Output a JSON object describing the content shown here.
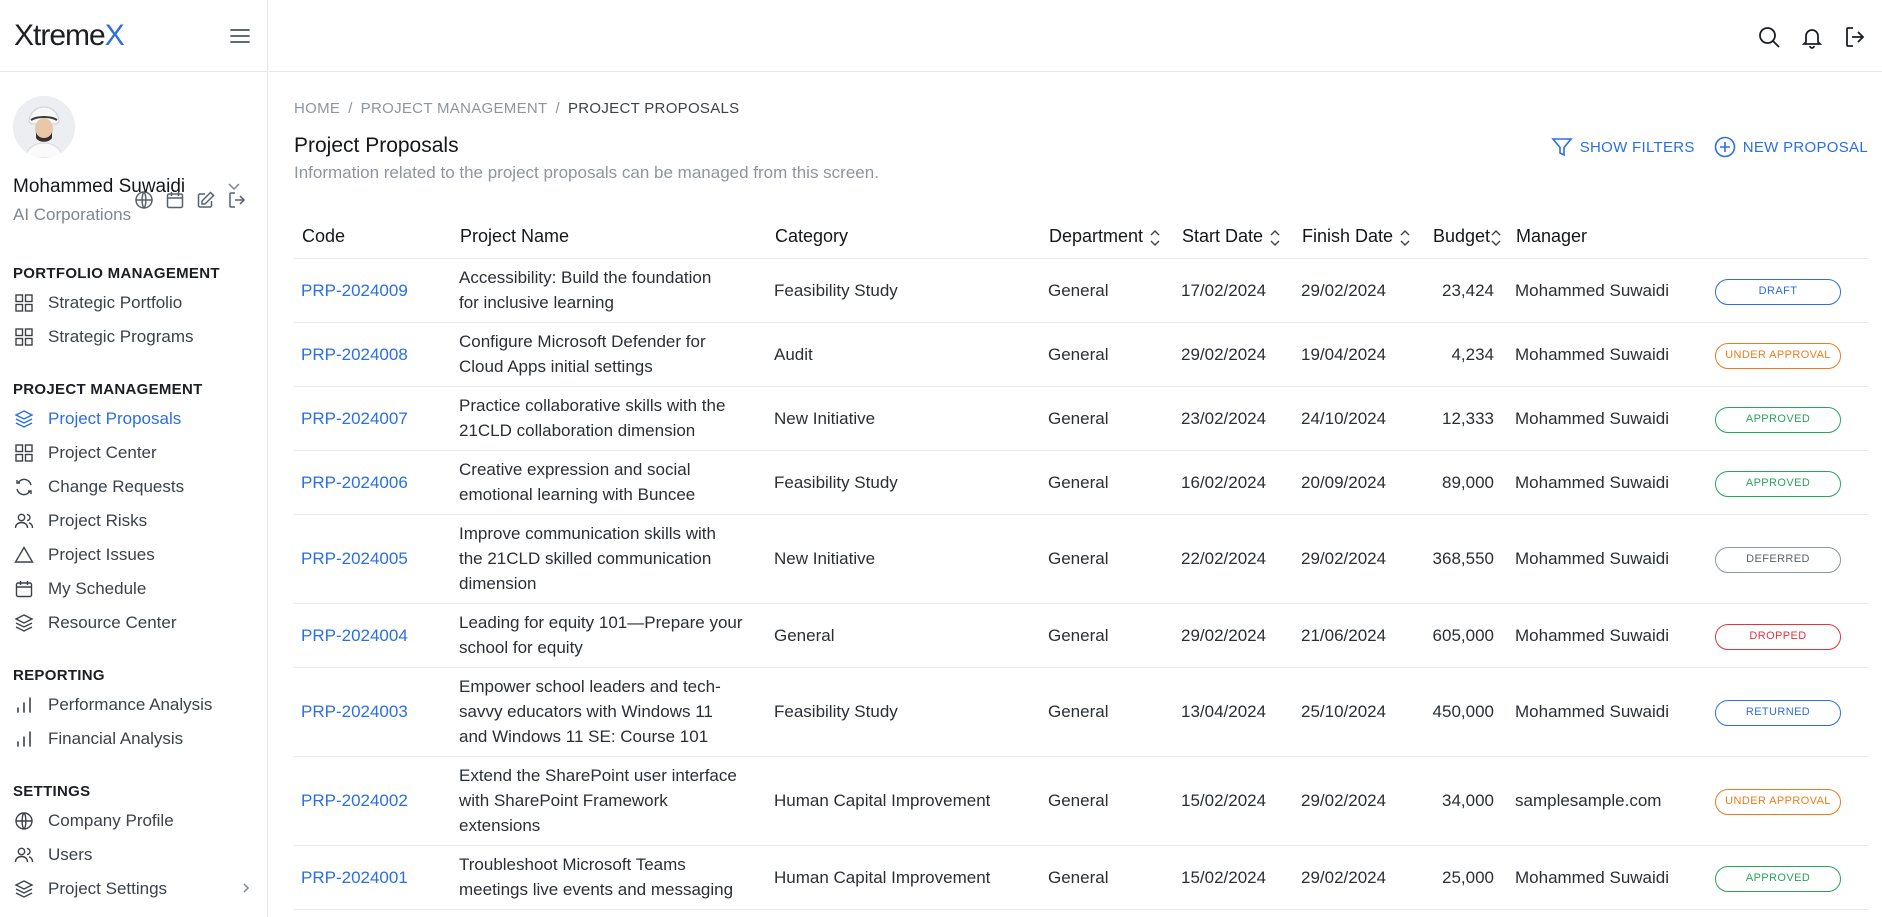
{
  "brand": {
    "prefix": "Xtreme",
    "suffix": "X"
  },
  "user": {
    "name": "Mohammed Suwaidi",
    "company": "AI Corporations"
  },
  "sidebar": {
    "sections": [
      {
        "title": "PORTFOLIO MANAGEMENT",
        "items": [
          {
            "label": "Strategic Portfolio",
            "icon": "grid-icon"
          },
          {
            "label": "Strategic Programs",
            "icon": "grid-icon"
          }
        ]
      },
      {
        "title": "PROJECT MANAGEMENT",
        "items": [
          {
            "label": "Project Proposals",
            "icon": "layers-icon",
            "active": true
          },
          {
            "label": "Project Center",
            "icon": "grid-icon"
          },
          {
            "label": "Change Requests",
            "icon": "refresh-icon"
          },
          {
            "label": "Project Risks",
            "icon": "users-icon"
          },
          {
            "label": "Project Issues",
            "icon": "warning-icon"
          },
          {
            "label": "My Schedule",
            "icon": "calendar-icon"
          },
          {
            "label": "Resource Center",
            "icon": "layers-icon"
          }
        ]
      },
      {
        "title": "REPORTING",
        "items": [
          {
            "label": "Performance Analysis",
            "icon": "bar-chart-icon"
          },
          {
            "label": "Financial Analysis",
            "icon": "bar-chart-icon"
          }
        ]
      },
      {
        "title": "SETTINGS",
        "items": [
          {
            "label": "Company Profile",
            "icon": "globe-icon"
          },
          {
            "label": "Users",
            "icon": "users-icon"
          },
          {
            "label": "Project Settings",
            "icon": "layers-icon",
            "has_submenu": true
          }
        ]
      }
    ]
  },
  "breadcrumb": {
    "home": "HOME",
    "section": "PROJECT MANAGEMENT",
    "current": "PROJECT PROPOSALS",
    "separator": "/"
  },
  "page": {
    "title": "Project Proposals",
    "subtitle": "Information related to the project proposals can be managed from this screen.",
    "show_filters": "SHOW FILTERS",
    "new_proposal": "NEW PROPOSAL"
  },
  "table": {
    "columns": {
      "code": "Code",
      "project_name": "Project Name",
      "category": "Category",
      "department": "Department",
      "start_date": "Start Date",
      "finish_date": "Finish Date",
      "budget": "Budget",
      "manager": "Manager"
    },
    "rows": [
      {
        "code": "PRP-2024009",
        "name": [
          "Accessibility: Build the foundation",
          "for inclusive learning"
        ],
        "category": "Feasibility Study",
        "department": "General",
        "start": "17/02/2024",
        "finish": "29/02/2024",
        "budget": "23,424",
        "manager": "Mohammed Suwaidi",
        "status": "DRAFT",
        "status_kind": "blue"
      },
      {
        "code": "PRP-2024008",
        "name": [
          "Configure Microsoft Defender for",
          "Cloud Apps initial settings"
        ],
        "category": "Audit",
        "department": "General",
        "start": "29/02/2024",
        "finish": "19/04/2024",
        "budget": "4,234",
        "manager": "Mohammed Suwaidi",
        "status": "UNDER APPROVAL",
        "status_kind": "orange"
      },
      {
        "code": "PRP-2024007",
        "name": [
          "Practice collaborative skills with the",
          "21CLD collaboration dimension"
        ],
        "category": "New Initiative",
        "department": "General",
        "start": "23/02/2024",
        "finish": "24/10/2024",
        "budget": "12,333",
        "manager": "Mohammed Suwaidi",
        "status": "APPROVED",
        "status_kind": "green"
      },
      {
        "code": "PRP-2024006",
        "name": [
          "Creative expression and social",
          "emotional learning with Buncee"
        ],
        "category": "Feasibility Study",
        "department": "General",
        "start": "16/02/2024",
        "finish": "20/09/2024",
        "budget": "89,000",
        "manager": "Mohammed Suwaidi",
        "status": "APPROVED",
        "status_kind": "green"
      },
      {
        "code": "PRP-2024005",
        "name": [
          "Improve communication skills with",
          "the 21CLD skilled communication",
          "dimension"
        ],
        "category": "New Initiative",
        "department": "General",
        "start": "22/02/2024",
        "finish": "29/02/2024",
        "budget": "368,550",
        "manager": "Mohammed Suwaidi",
        "status": "DEFERRED",
        "status_kind": "gray"
      },
      {
        "code": "PRP-2024004",
        "name": [
          "Leading for equity 101—Prepare your",
          "school for equity"
        ],
        "category": "General",
        "department": "General",
        "start": "29/02/2024",
        "finish": "21/06/2024",
        "budget": "605,000",
        "manager": "Mohammed Suwaidi",
        "status": "DROPPED",
        "status_kind": "red"
      },
      {
        "code": "PRP-2024003",
        "name": [
          "Empower school leaders and tech-",
          "savvy educators with Windows 11",
          "and Windows 11 SE: Course 101"
        ],
        "category": "Feasibility Study",
        "department": "General",
        "start": "13/04/2024",
        "finish": "25/10/2024",
        "budget": "450,000",
        "manager": "Mohammed Suwaidi",
        "status": "RETURNED",
        "status_kind": "blue"
      },
      {
        "code": "PRP-2024002",
        "name": [
          "Extend the SharePoint user interface",
          "with SharePoint Framework",
          "extensions"
        ],
        "category": "Human Capital Improvement",
        "department": "General",
        "start": "15/02/2024",
        "finish": "29/02/2024",
        "budget": "34,000",
        "manager": "samplesample.com",
        "status": "UNDER APPROVAL",
        "status_kind": "orange"
      },
      {
        "code": "PRP-2024001",
        "name": [
          "Troubleshoot Microsoft Teams",
          "meetings live events and messaging"
        ],
        "category": "Human Capital Improvement",
        "department": "General",
        "start": "15/02/2024",
        "finish": "29/02/2024",
        "budget": "25,000",
        "manager": "Mohammed Suwaidi",
        "status": "APPROVED",
        "status_kind": "green"
      }
    ]
  }
}
